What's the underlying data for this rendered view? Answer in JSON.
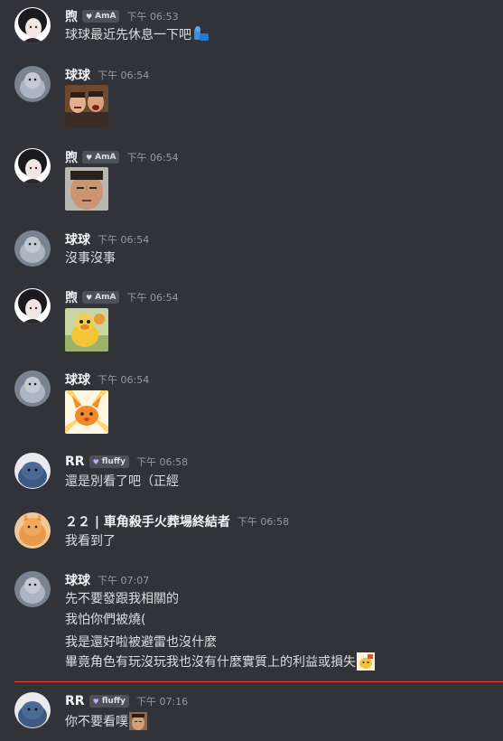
{
  "messages": [
    {
      "username": "煦",
      "tag": "AmA",
      "time": "下午 06:53",
      "lines": [
        "球球最近先休息一下吧"
      ],
      "has_inline_emoji": true
    },
    {
      "username": "球球",
      "time": "下午 06:54",
      "lines": [],
      "sticker": "two-men-laughing-sticker"
    },
    {
      "username": "煦",
      "tag": "AmA",
      "time": "下午 06:54",
      "lines": [],
      "sticker": "sleepy-face-sticker"
    },
    {
      "username": "球球",
      "time": "下午 06:54",
      "lines": [
        "沒事沒事"
      ]
    },
    {
      "username": "煦",
      "tag": "AmA",
      "time": "下午 06:54",
      "lines": [],
      "sticker": "yellow-duck-sticker"
    },
    {
      "username": "球球",
      "time": "下午 06:54",
      "lines": [],
      "sticker": "orange-creature-sticker"
    },
    {
      "username": "RR",
      "tag": "fluffy",
      "time": "下午 06:58",
      "lines": [
        "還是別看了吧（正經"
      ]
    },
    {
      "username": "２２ | 車角殺手火葬場終結者",
      "time": "下午 06:58",
      "lines": [
        "我看到了"
      ]
    },
    {
      "username": "球球",
      "time": "下午 07:07",
      "lines": [
        "先不要發跟我相關的",
        "我怕你們被燒(",
        "我是還好啦被避雷也沒什麼",
        "畢竟角色有玩沒玩我也沒有什麼實質上的利益或損失"
      ]
    },
    {
      "username": "RR",
      "tag": "fluffy",
      "time": "下午 07:16",
      "lines": [
        "你不要看噗"
      ]
    }
  ],
  "colors": {
    "background": "#313338",
    "new_messages_divider": "#f23f42",
    "username": "#f2f3f5",
    "timestamp": "#949ba4"
  }
}
